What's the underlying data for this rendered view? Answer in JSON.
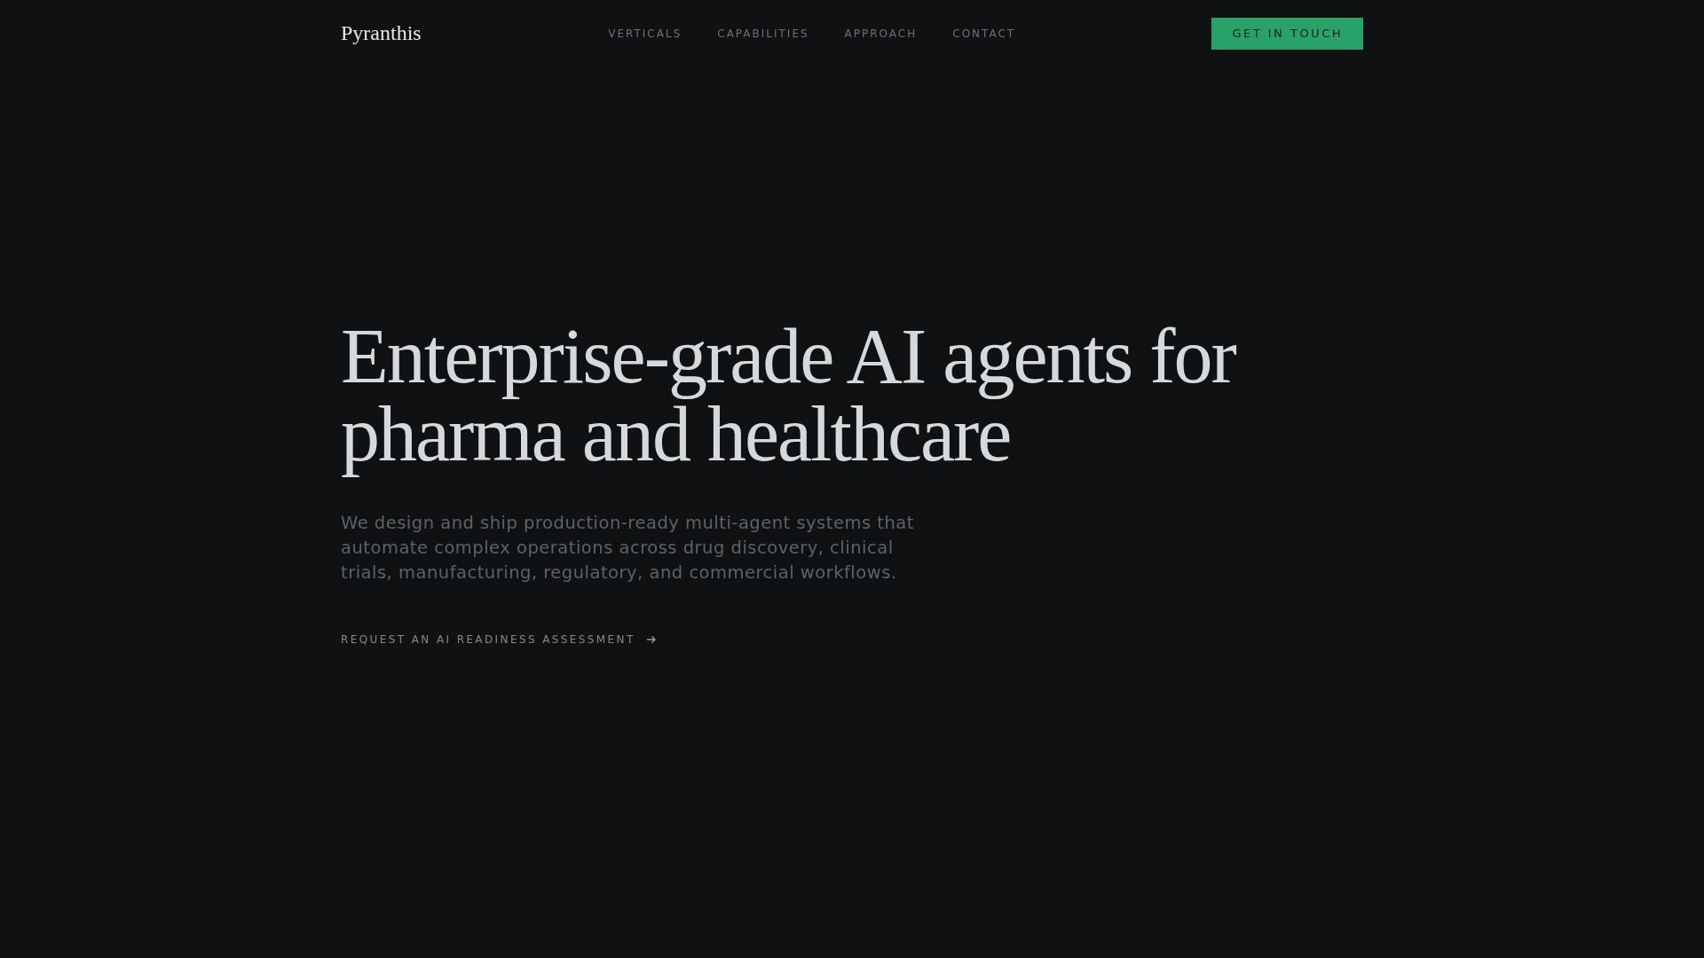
{
  "header": {
    "logo": "Pyranthis",
    "nav": [
      "VERTICALS",
      "CAPABILITIES",
      "APPROACH",
      "CONTACT"
    ],
    "cta": "GET IN TOUCH"
  },
  "hero": {
    "title": "Enterprise-grade AI agents for pharma and healthcare",
    "subtitle": "We design and ship production-ready multi-agent systems that automate complex operations across drug discovery, clinical trials, manufacturing, regulatory, and commercial workflows.",
    "link": "REQUEST AN AI READINESS ASSESSMENT"
  }
}
